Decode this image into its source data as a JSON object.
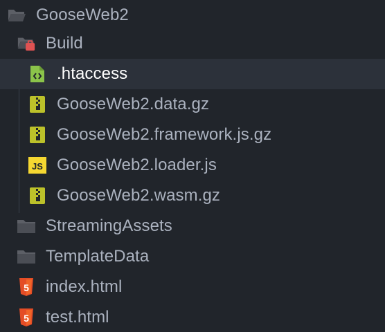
{
  "tree": {
    "root": {
      "label": "GooseWeb2",
      "icon": "folder-open-icon"
    },
    "build": {
      "label": "Build",
      "icon": "folder-open-icon",
      "badge_color": "#e05252"
    },
    "build_files": [
      {
        "label": ".htaccess",
        "icon": "config-file-icon",
        "selected": true
      },
      {
        "label": "GooseWeb2.data.gz",
        "icon": "archive-icon"
      },
      {
        "label": "GooseWeb2.framework.js.gz",
        "icon": "archive-icon"
      },
      {
        "label": "GooseWeb2.loader.js",
        "icon": "js-icon",
        "icon_text": "JS"
      },
      {
        "label": "GooseWeb2.wasm.gz",
        "icon": "archive-icon"
      }
    ],
    "folders": [
      {
        "label": "StreamingAssets",
        "icon": "folder-icon"
      },
      {
        "label": "TemplateData",
        "icon": "folder-icon"
      }
    ],
    "files": [
      {
        "label": "index.html",
        "icon": "html5-icon",
        "icon_text": "5"
      },
      {
        "label": "test.html",
        "icon": "html5-icon",
        "icon_text": "5"
      }
    ]
  },
  "colors": {
    "background": "#21252b",
    "selected_row": "#2c313a",
    "text": "#abb2bf",
    "folder": "#5c5f66",
    "archive": "#bcc12a",
    "js": "#f5d731",
    "html": "#e44d26",
    "config": "#8bc34a"
  }
}
